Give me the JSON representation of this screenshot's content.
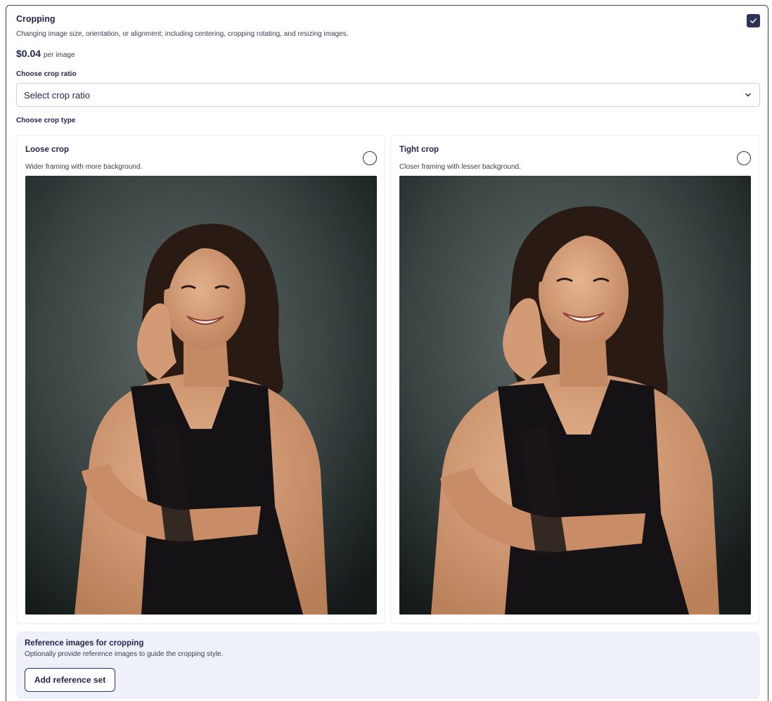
{
  "section": {
    "title": "Cropping",
    "description": "Changing image size, orientation, or alignment; including centering, cropping rotating, and resizing images.",
    "checked": true,
    "price_amount": "$0.04",
    "price_unit": "per image"
  },
  "crop_ratio": {
    "label": "Choose crop ratio",
    "placeholder": "Select crop ratio"
  },
  "crop_type": {
    "label": "Choose crop type",
    "options": [
      {
        "title": "Loose crop",
        "description": "Wider framing with more background.",
        "selected": false,
        "image": "portrait-photo-loose"
      },
      {
        "title": "Tight crop",
        "description": "Closer framing with lesser background.",
        "selected": false,
        "image": "portrait-photo-tight"
      }
    ]
  },
  "reference": {
    "title": "Reference images for cropping",
    "description": "Optionally provide reference images to guide the cropping style.",
    "button_label": "Add reference set"
  },
  "colors": {
    "accent": "#2e3158",
    "panel_bg": "#eef0fa",
    "border": "#3b3f63"
  },
  "icons": {
    "checkbox": "checkmark-icon",
    "select": "chevron-down-icon"
  }
}
